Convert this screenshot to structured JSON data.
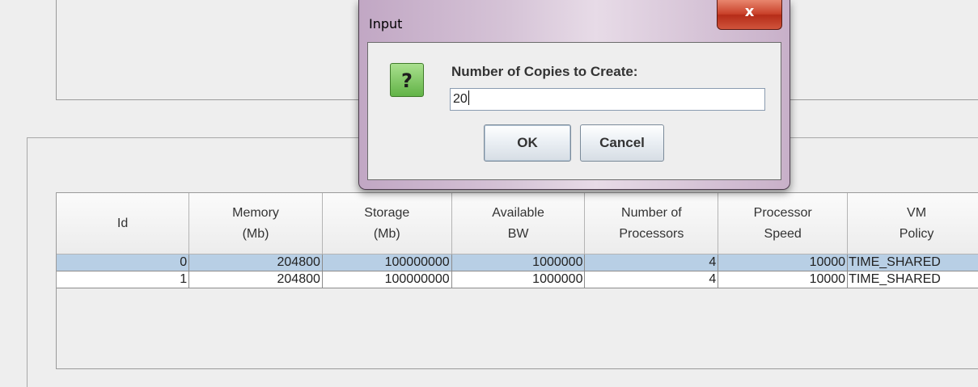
{
  "dialog": {
    "title": "Input",
    "close_glyph": "x",
    "icon": "question-icon",
    "icon_glyph": "?",
    "prompt": "Number of Copies to Create:",
    "input_value": "20",
    "ok_label": "OK",
    "cancel_label": "Cancel"
  },
  "table": {
    "columns": [
      "Id",
      "Memory\n(Mb)",
      "Storage\n(Mb)",
      "Available\nBW",
      "Number of\nProcessors",
      "Processor\nSpeed",
      "VM\nPolicy"
    ],
    "rows": [
      {
        "cells": [
          "0",
          "204800",
          "100000000",
          "1000000",
          "4",
          "10000",
          "TIME_SHARED"
        ],
        "selected": true
      },
      {
        "cells": [
          "1",
          "204800",
          "100000000",
          "1000000",
          "4",
          "10000",
          "TIME_SHARED"
        ],
        "selected": false
      }
    ]
  },
  "colors": {
    "selected_row": "#b8cfe5",
    "close_button": "#c9412a",
    "question_icon": "#62b347"
  }
}
